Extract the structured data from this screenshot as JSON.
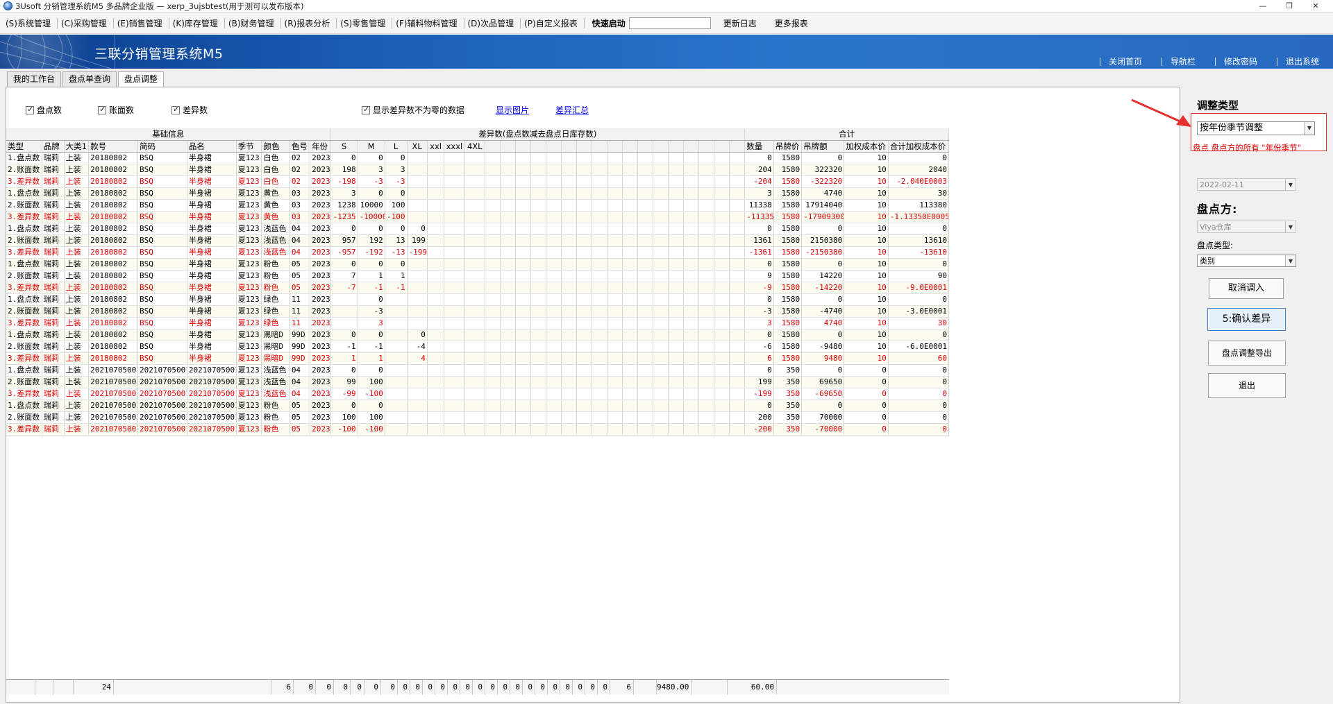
{
  "window": {
    "title": "3Usoft 分销管理系统M5 多品牌企业版 — xerp_3ujsbtest(用于测可以发布版本)",
    "buttons": [
      "—",
      "❐",
      "✕"
    ]
  },
  "menubar": {
    "items": [
      "(S)系统管理",
      "(C)采购管理",
      "(E)销售管理",
      "(K)库存管理",
      "(B)财务管理",
      "(R)报表分析",
      "(S)零售管理",
      "(F)辅料物料管理",
      "(D)次品管理",
      "(P)自定义报表"
    ],
    "quick_label": "快速启动",
    "quick_value": "",
    "extra": [
      "更新日志",
      "更多报表"
    ]
  },
  "banner": {
    "title": "三联分销管理系统M5",
    "links": [
      "关闭首页",
      "导航栏",
      "修改密码",
      "退出系统"
    ]
  },
  "tabs": [
    "我的工作台",
    "盘点单查询",
    "盘点调整"
  ],
  "active_tab": 2,
  "options": {
    "cb1": "盘点数",
    "cb2": "账面数",
    "cb3": "差异数",
    "cb4": "显示差异数不为零的数据",
    "link1": "显示图片",
    "link2": "差异汇总"
  },
  "grid": {
    "group_headers": {
      "basic": "基础信息",
      "diff": "差异数(盘点数减去盘点日库存数)",
      "total": "合计"
    },
    "columns": [
      "类型",
      "品牌",
      "大类1",
      "款号",
      "简码",
      "品名",
      "季节",
      "颜色",
      "色号",
      "年份",
      "S",
      "M",
      "L",
      "XL",
      "xxl",
      "xxxl",
      "4XL",
      "",
      "",
      "",
      "",
      "",
      "",
      "",
      "",
      "",
      "",
      "",
      "",
      "",
      "",
      "",
      "",
      "",
      "数量",
      "吊牌价",
      "吊牌额",
      "加权成本价",
      "合计加权成本价"
    ],
    "rows": [
      [
        "1.盘点数",
        "瑞莉",
        "上装",
        "20180802",
        "BSQ",
        "半身裙",
        "夏123",
        "白色",
        "02",
        "2023",
        "0",
        "0",
        "0",
        "",
        "",
        "",
        "",
        "0",
        "1580",
        "0",
        "10",
        "0"
      ],
      [
        "2.账面数",
        "瑞莉",
        "上装",
        "20180802",
        "BSQ",
        "半身裙",
        "夏123",
        "白色",
        "02",
        "2023",
        "198",
        "3",
        "3",
        "",
        "",
        "",
        "",
        "204",
        "1580",
        "322320",
        "10",
        "2040"
      ],
      [
        "3.差异数",
        "瑞莉",
        "上装",
        "20180802",
        "BSQ",
        "半身裙",
        "夏123",
        "白色",
        "02",
        "2023",
        "-198",
        "-3",
        "-3",
        "",
        "",
        "",
        "",
        "-204",
        "1580",
        "-322320",
        "10",
        "-2.040E0003"
      ],
      [
        "1.盘点数",
        "瑞莉",
        "上装",
        "20180802",
        "BSQ",
        "半身裙",
        "夏123",
        "黄色",
        "03",
        "2023",
        "3",
        "0",
        "0",
        "",
        "",
        "",
        "",
        "3",
        "1580",
        "4740",
        "10",
        "30"
      ],
      [
        "2.账面数",
        "瑞莉",
        "上装",
        "20180802",
        "BSQ",
        "半身裙",
        "夏123",
        "黄色",
        "03",
        "2023",
        "1238",
        "10000",
        "100",
        "",
        "",
        "",
        "",
        "11338",
        "1580",
        "17914040",
        "10",
        "113380"
      ],
      [
        "3.差异数",
        "瑞莉",
        "上装",
        "20180802",
        "BSQ",
        "半身裙",
        "夏123",
        "黄色",
        "03",
        "2023",
        "-1235",
        "-10000",
        "-100",
        "",
        "",
        "",
        "",
        "-11335",
        "1580",
        "-17909300",
        "10",
        "-1.13350E0005"
      ],
      [
        "1.盘点数",
        "瑞莉",
        "上装",
        "20180802",
        "BSQ",
        "半身裙",
        "夏123",
        "浅蓝色",
        "04",
        "2023",
        "0",
        "0",
        "0",
        "0",
        "",
        "",
        "",
        "0",
        "1580",
        "0",
        "10",
        "0"
      ],
      [
        "2.账面数",
        "瑞莉",
        "上装",
        "20180802",
        "BSQ",
        "半身裙",
        "夏123",
        "浅蓝色",
        "04",
        "2023",
        "957",
        "192",
        "13",
        "199",
        "",
        "",
        "",
        "1361",
        "1580",
        "2150380",
        "10",
        "13610"
      ],
      [
        "3.差异数",
        "瑞莉",
        "上装",
        "20180802",
        "BSQ",
        "半身裙",
        "夏123",
        "浅蓝色",
        "04",
        "2023",
        "-957",
        "-192",
        "-13",
        "-199",
        "",
        "",
        "",
        "-1361",
        "1580",
        "-2150380",
        "10",
        "-13610"
      ],
      [
        "1.盘点数",
        "瑞莉",
        "上装",
        "20180802",
        "BSQ",
        "半身裙",
        "夏123",
        "粉色",
        "05",
        "2023",
        "0",
        "0",
        "0",
        "",
        "",
        "",
        "",
        "0",
        "1580",
        "0",
        "10",
        "0"
      ],
      [
        "2.账面数",
        "瑞莉",
        "上装",
        "20180802",
        "BSQ",
        "半身裙",
        "夏123",
        "粉色",
        "05",
        "2023",
        "7",
        "1",
        "1",
        "",
        "",
        "",
        "",
        "9",
        "1580",
        "14220",
        "10",
        "90"
      ],
      [
        "3.差异数",
        "瑞莉",
        "上装",
        "20180802",
        "BSQ",
        "半身裙",
        "夏123",
        "粉色",
        "05",
        "2023",
        "-7",
        "-1",
        "-1",
        "",
        "",
        "",
        "",
        "-9",
        "1580",
        "-14220",
        "10",
        "-9.0E0001"
      ],
      [
        "1.盘点数",
        "瑞莉",
        "上装",
        "20180802",
        "BSQ",
        "半身裙",
        "夏123",
        "绿色",
        "11",
        "2023",
        "",
        "0",
        "",
        "",
        "",
        "",
        "",
        "0",
        "1580",
        "0",
        "10",
        "0"
      ],
      [
        "2.账面数",
        "瑞莉",
        "上装",
        "20180802",
        "BSQ",
        "半身裙",
        "夏123",
        "绿色",
        "11",
        "2023",
        "",
        "-3",
        "",
        "",
        "",
        "",
        "",
        "-3",
        "1580",
        "-4740",
        "10",
        "-3.0E0001"
      ],
      [
        "3.差异数",
        "瑞莉",
        "上装",
        "20180802",
        "BSQ",
        "半身裙",
        "夏123",
        "绿色",
        "11",
        "2023",
        "",
        "3",
        "",
        "",
        "",
        "",
        "",
        "3",
        "1580",
        "4740",
        "10",
        "30"
      ],
      [
        "1.盘点数",
        "瑞莉",
        "上装",
        "20180802",
        "BSQ",
        "半身裙",
        "夏123",
        "黑暗D",
        "99D",
        "2023",
        "0",
        "0",
        "",
        "0",
        "",
        "",
        "",
        "0",
        "1580",
        "0",
        "10",
        "0"
      ],
      [
        "2.账面数",
        "瑞莉",
        "上装",
        "20180802",
        "BSQ",
        "半身裙",
        "夏123",
        "黑暗D",
        "99D",
        "2023",
        "-1",
        "-1",
        "",
        "-4",
        "",
        "",
        "",
        "-6",
        "1580",
        "-9480",
        "10",
        "-6.0E0001"
      ],
      [
        "3.差异数",
        "瑞莉",
        "上装",
        "20180802",
        "BSQ",
        "半身裙",
        "夏123",
        "黑暗D",
        "99D",
        "2023",
        "1",
        "1",
        "",
        "4",
        "",
        "",
        "",
        "6",
        "1580",
        "9480",
        "10",
        "60"
      ],
      [
        "1.盘点数",
        "瑞莉",
        "上装",
        "20210705001",
        "20210705001",
        "20210705001",
        "夏123",
        "浅蓝色",
        "04",
        "2023",
        "0",
        "0",
        "",
        "",
        "",
        "",
        "",
        "0",
        "350",
        "0",
        "0",
        "0"
      ],
      [
        "2.账面数",
        "瑞莉",
        "上装",
        "20210705001",
        "20210705001",
        "20210705001",
        "夏123",
        "浅蓝色",
        "04",
        "2023",
        "99",
        "100",
        "",
        "",
        "",
        "",
        "",
        "199",
        "350",
        "69650",
        "0",
        "0"
      ],
      [
        "3.差异数",
        "瑞莉",
        "上装",
        "20210705001",
        "20210705001",
        "20210705001",
        "夏123",
        "浅蓝色",
        "04",
        "2023",
        "-99",
        "-100",
        "",
        "",
        "",
        "",
        "",
        "-199",
        "350",
        "-69650",
        "0",
        "0"
      ],
      [
        "1.盘点数",
        "瑞莉",
        "上装",
        "20210705001",
        "20210705001",
        "20210705001",
        "夏123",
        "粉色",
        "05",
        "2023",
        "0",
        "0",
        "",
        "",
        "",
        "",
        "",
        "0",
        "350",
        "0",
        "0",
        "0"
      ],
      [
        "2.账面数",
        "瑞莉",
        "上装",
        "20210705001",
        "20210705001",
        "20210705001",
        "夏123",
        "粉色",
        "05",
        "2023",
        "100",
        "100",
        "",
        "",
        "",
        "",
        "",
        "200",
        "350",
        "70000",
        "0",
        "0"
      ],
      [
        "3.差异数",
        "瑞莉",
        "上装",
        "20210705001",
        "20210705001",
        "20210705001",
        "夏123",
        "粉色",
        "05",
        "2023",
        "-100",
        "-100",
        "",
        "",
        "",
        "",
        "",
        "-200",
        "350",
        "-70000",
        "0",
        "0"
      ]
    ],
    "footer": {
      "count": "24",
      "sizes": [
        "6",
        "0",
        "0",
        "0",
        "0",
        "0",
        "0",
        "0",
        "0",
        "0",
        "0",
        "0",
        "0",
        "0",
        "0",
        "0",
        "0",
        "0",
        "0",
        "0",
        "0",
        "0",
        "0",
        "0"
      ],
      "qty": "6",
      "amount": "9480.00",
      "cost": "60.00"
    }
  },
  "side": {
    "adjust_type_label": "调整类型",
    "adjust_type_value": "按年份季节调整",
    "note": "盘点 盘点方的所有 \"年份季节\"",
    "date_value": "2022-02-11",
    "counter_label": "盘点方:",
    "counter_value": "Viya仓库",
    "count_type_label": "盘点类型:",
    "count_type_value": "类别",
    "btn_cancel": "取消调入",
    "btn_confirm": "5:确认差异",
    "btn_export": "盘点调整导出",
    "btn_exit": "退出"
  },
  "colors": {
    "diff_row": "#e00000",
    "banner": "#1c5fb8",
    "annotation": "#e63030"
  }
}
